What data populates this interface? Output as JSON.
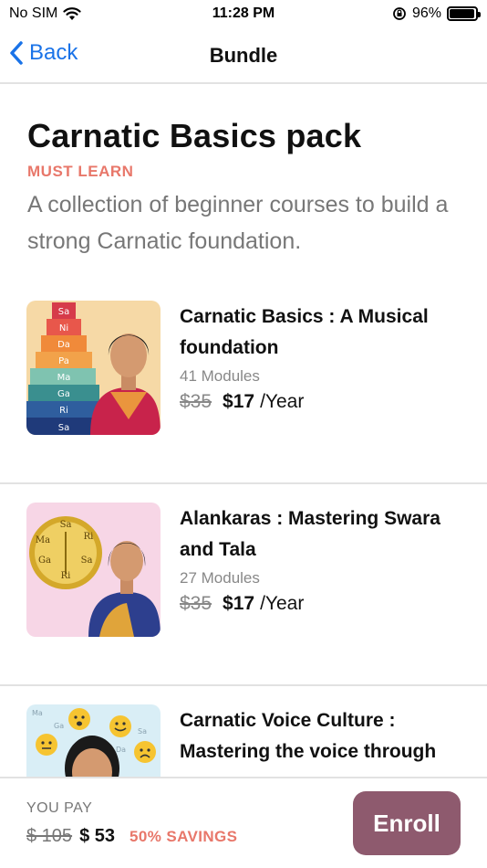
{
  "status_bar": {
    "carrier": "No SIM",
    "time": "11:28 PM",
    "battery_percent": "96%",
    "battery_level": 0.96
  },
  "nav": {
    "back_label": "Back",
    "title": "Bundle"
  },
  "bundle": {
    "title": "Carnatic Basics pack",
    "tag": "MUST LEARN",
    "description": "A collection of beginner courses to build a strong Carnatic foundation."
  },
  "courses": [
    {
      "title": "Carnatic Basics : A Musical foundation",
      "modules": "41 Modules",
      "old_price": "$35",
      "new_price": "$17",
      "period": "/Year",
      "swara_steps": [
        "Sa",
        "Ni",
        "Da",
        "Pa",
        "Ma",
        "Ga",
        "Ri",
        "Sa"
      ]
    },
    {
      "title": "Alankaras : Mastering Swara and Tala",
      "modules": "27 Modules",
      "old_price": "$35",
      "new_price": "$17",
      "period": "/Year",
      "clock_labels": [
        "Sa",
        "Ri",
        "Ma",
        "Ga",
        "Sa",
        "Ri"
      ]
    },
    {
      "title": "Carnatic Voice Culture : Mastering the voice through",
      "modules": "",
      "old_price": "",
      "new_price": "",
      "period": "",
      "bubble_labels": [
        "Ma",
        "Ga",
        "Sa",
        "Da"
      ]
    }
  ],
  "footer": {
    "you_pay_label": "YOU PAY",
    "old_total": "$ 105",
    "new_total": "$ 53",
    "savings": "50% SAVINGS",
    "enroll_label": "Enroll"
  },
  "colors": {
    "accent_blue": "#1a73e8",
    "tag_coral": "#e8776a",
    "enroll_bg": "#8e5a6e"
  }
}
